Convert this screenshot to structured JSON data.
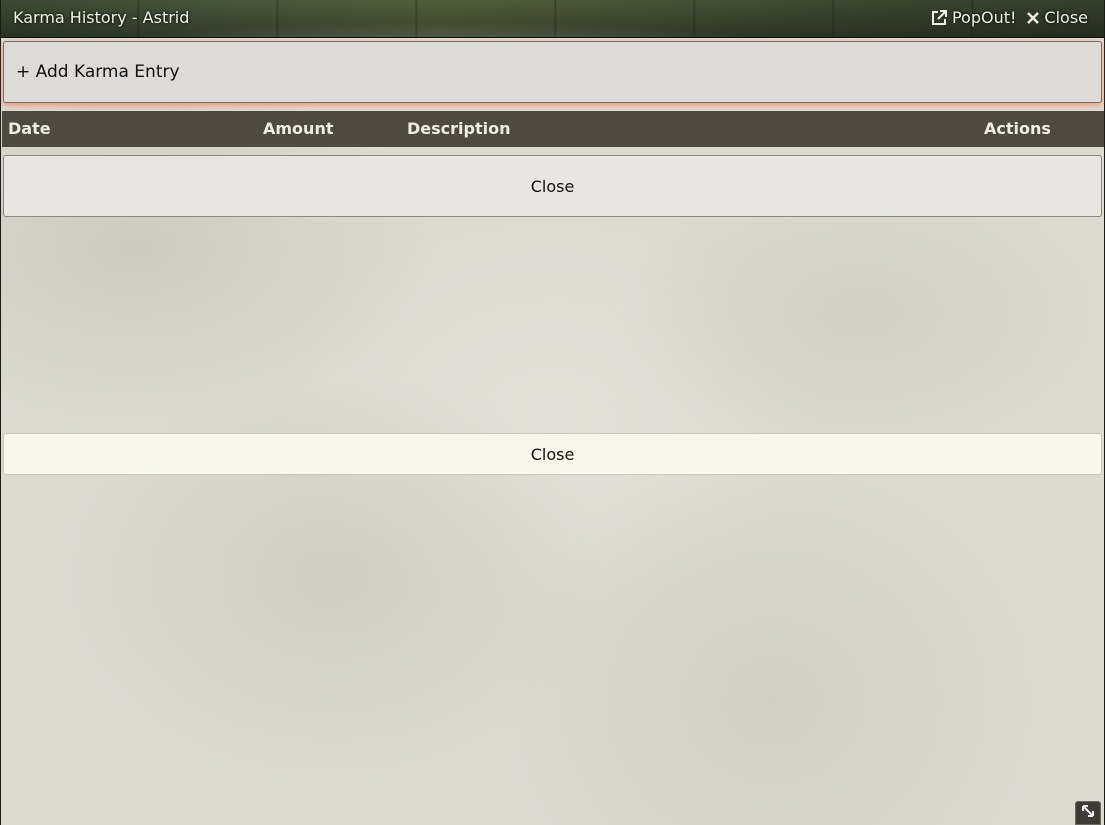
{
  "window": {
    "title": "Karma History - Astrid",
    "popout_label": "PopOut!",
    "close_label": "Close"
  },
  "add_entry": {
    "label": "+ Add Karma Entry"
  },
  "table": {
    "columns": [
      "Date",
      "Amount",
      "Description",
      "Actions"
    ],
    "rows": []
  },
  "buttons": {
    "close_primary": "Close",
    "close_secondary": "Close"
  },
  "icons": {
    "popout": "external-link-icon",
    "close": "close-x-icon",
    "resize": "resize-arrows-icon"
  },
  "colors": {
    "header_bg": "#4f4a40",
    "add_entry_glow": "#ff503c",
    "panel_bg": "#dcdbd2"
  }
}
